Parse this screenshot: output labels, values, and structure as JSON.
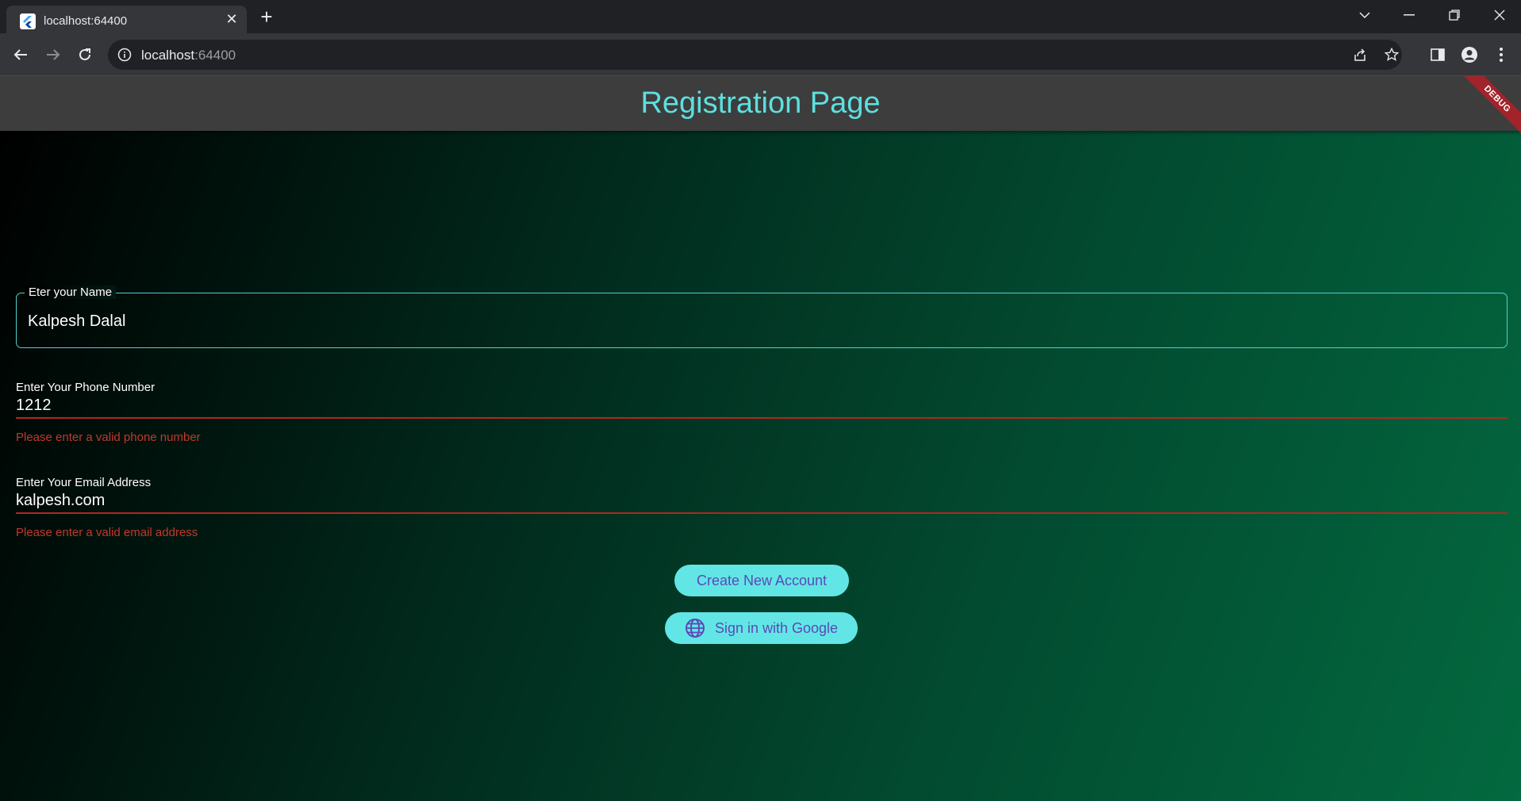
{
  "browser": {
    "tab_title": "localhost:64400",
    "url_host": "localhost",
    "url_port": ":64400",
    "icons": [
      "flutter-icon",
      "close-icon",
      "plus-icon",
      "chevron-down-icon",
      "minimize-icon",
      "restore-icon",
      "window-close-icon",
      "back-arrow-icon",
      "forward-arrow-icon",
      "reload-icon",
      "info-icon",
      "share-icon",
      "star-icon",
      "sidebar-icon",
      "profile-icon",
      "kebab-menu-icon"
    ]
  },
  "app": {
    "title": "Registration Page",
    "debug_banner": "DEBUG",
    "name_field": {
      "label": "Eter your Name",
      "value": "Kalpesh Dalal"
    },
    "phone_field": {
      "label": "Enter Your Phone Number",
      "value": "1212",
      "error": "Please enter a valid phone number"
    },
    "email_field": {
      "label": "Enter Your Email Address",
      "value": "kalpesh.com",
      "error": "Please enter a valid email address"
    },
    "create_button": "Create New Account",
    "google_button": "Sign in with Google",
    "colors": {
      "accent": "#5ce0df",
      "error": "#b3261e",
      "button_text": "#5b49b8",
      "appbar": "#3d3d3d"
    }
  }
}
